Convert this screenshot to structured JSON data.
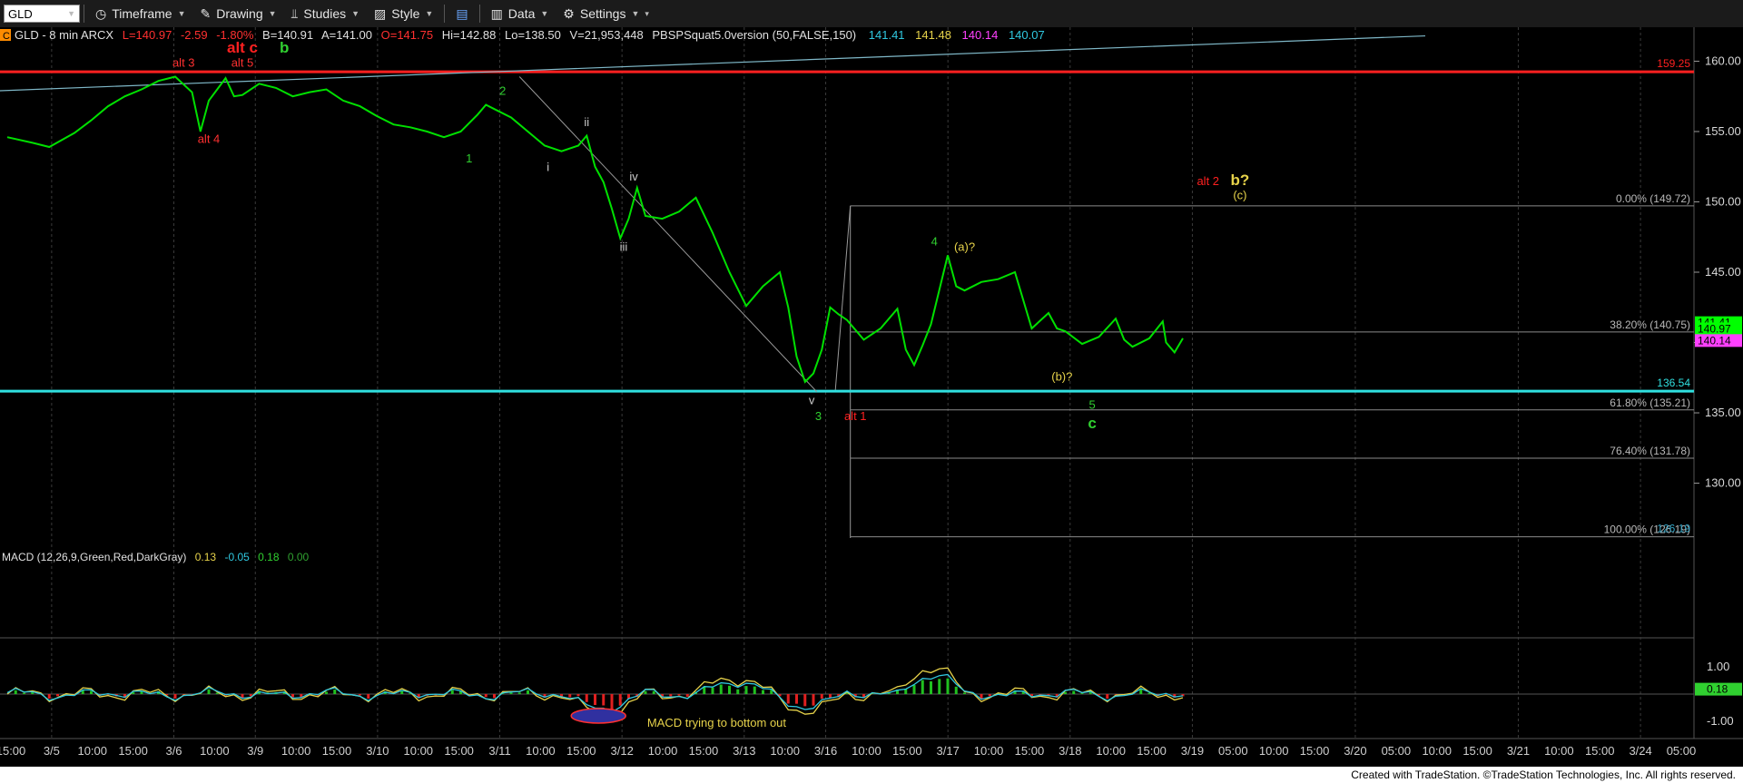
{
  "toolbar": {
    "symbol": "GLD",
    "timeframe": "Timeframe",
    "drawing": "Drawing",
    "studies": "Studies",
    "style": "Style",
    "data": "Data",
    "settings": "Settings"
  },
  "header": {
    "badge": "C",
    "title": "GLD - 8 min  ARCX",
    "L": "L=140.97",
    "chg": "-2.59",
    "pct": "-1.80%",
    "B": "B=140.91",
    "A": "A=141.00",
    "O": "O=141.75",
    "Hi": "Hi=142.88",
    "Lo": "Lo=138.50",
    "V": "V=21,953,448",
    "study": "PBSPSquat5.0version (50,FALSE,150)",
    "study_values": [
      "141.41",
      "141.48",
      "140.14",
      "140.07"
    ]
  },
  "macd_header": {
    "label": "MACD (12,26,9,Green,Red,DarkGray)",
    "v1": "0.13",
    "v2": "-0.05",
    "v3": "0.18",
    "v4": "0.00"
  },
  "footer": "Created with TradeStation. ©TradeStation Technologies, Inc. All rights reserved.",
  "colors": {
    "price": "#00ff00",
    "red_line": "#ff2020",
    "cyan_line": "#30e0e0",
    "grid": "#3a3a3a"
  },
  "chart_data": {
    "type": "line",
    "symbol": "GLD",
    "interval": "8 min",
    "ylim": [
      126.1,
      161.9
    ],
    "y_ticks": [
      130,
      135,
      140,
      145,
      150,
      155,
      160
    ],
    "x_ticks": [
      "15:00",
      "3/5",
      "10:00",
      "15:00",
      "3/6",
      "10:00",
      "3/9",
      "10:00",
      "15:00",
      "3/10",
      "10:00",
      "15:00",
      "3/11",
      "10:00",
      "15:00",
      "3/12",
      "10:00",
      "15:00",
      "3/13",
      "10:00",
      "3/16",
      "10:00",
      "15:00",
      "3/17",
      "10:00",
      "15:00",
      "3/18",
      "10:00",
      "15:00",
      "3/19",
      "05:00",
      "10:00",
      "15:00",
      "3/20",
      "05:00",
      "10:00",
      "15:00",
      "3/21",
      "10:00",
      "15:00",
      "3/24",
      "05:00"
    ],
    "price_path": [
      [
        0,
        154.6
      ],
      [
        1.5,
        154.2
      ],
      [
        2.5,
        153.9
      ],
      [
        4,
        154.9
      ],
      [
        5,
        155.8
      ],
      [
        6,
        156.8
      ],
      [
        7,
        157.5
      ],
      [
        8,
        158.0
      ],
      [
        9,
        158.6
      ],
      [
        10,
        158.9
      ],
      [
        11,
        157.8
      ],
      [
        11.5,
        155.0
      ],
      [
        12,
        157.2
      ],
      [
        13,
        158.8
      ],
      [
        13.5,
        157.5
      ],
      [
        14,
        157.6
      ],
      [
        15,
        158.4
      ],
      [
        16,
        158.1
      ],
      [
        17,
        157.5
      ],
      [
        18,
        157.8
      ],
      [
        19,
        158.0
      ],
      [
        20,
        157.2
      ],
      [
        21,
        156.8
      ],
      [
        22,
        156.1
      ],
      [
        23,
        155.5
      ],
      [
        24,
        155.3
      ],
      [
        25,
        155.0
      ],
      [
        26,
        154.6
      ],
      [
        27,
        155.0
      ],
      [
        28,
        156.2
      ],
      [
        28.5,
        156.9
      ],
      [
        29,
        156.6
      ],
      [
        30,
        156.0
      ],
      [
        31,
        155.0
      ],
      [
        32,
        154.0
      ],
      [
        33,
        153.6
      ],
      [
        34,
        154.0
      ],
      [
        34.5,
        154.7
      ],
      [
        35,
        152.5
      ],
      [
        35.5,
        151.4
      ],
      [
        36,
        149.5
      ],
      [
        36.5,
        147.4
      ],
      [
        37,
        148.8
      ],
      [
        37.5,
        151.0
      ],
      [
        38,
        149.0
      ],
      [
        39,
        148.8
      ],
      [
        40,
        149.3
      ],
      [
        41,
        150.3
      ],
      [
        42,
        147.8
      ],
      [
        43,
        145.0
      ],
      [
        44,
        142.6
      ],
      [
        45,
        144.0
      ],
      [
        46,
        145.0
      ],
      [
        46.5,
        142.5
      ],
      [
        47,
        139.0
      ],
      [
        47.5,
        137.2
      ],
      [
        48,
        137.8
      ],
      [
        48.5,
        139.5
      ],
      [
        49,
        142.5
      ],
      [
        49.5,
        142.0
      ],
      [
        50,
        141.6
      ],
      [
        51,
        140.2
      ],
      [
        52,
        141.0
      ],
      [
        53,
        142.4
      ],
      [
        53.5,
        139.5
      ],
      [
        54,
        138.4
      ],
      [
        54.5,
        139.8
      ],
      [
        55,
        141.3
      ],
      [
        56,
        146.2
      ],
      [
        56.5,
        144.0
      ],
      [
        57,
        143.7
      ],
      [
        58,
        144.3
      ],
      [
        59,
        144.5
      ],
      [
        60,
        145.0
      ],
      [
        61,
        141.0
      ],
      [
        62,
        142.1
      ],
      [
        62.5,
        141.0
      ],
      [
        63,
        140.8
      ],
      [
        64,
        139.9
      ],
      [
        65,
        140.4
      ],
      [
        66,
        141.7
      ],
      [
        66.5,
        140.2
      ],
      [
        67,
        139.7
      ],
      [
        68,
        140.3
      ],
      [
        68.8,
        141.5
      ],
      [
        69,
        140.0
      ],
      [
        69.5,
        139.3
      ],
      [
        70,
        140.3
      ]
    ],
    "time_span": [
      0,
      100
    ],
    "axis_tags": [
      {
        "value": 159.25,
        "label": "159.25",
        "color": "#ff2020"
      },
      {
        "value": 141.41,
        "label": "141.41",
        "color": "#00ff00"
      },
      {
        "value": 140.97,
        "label": "140.97",
        "color": "#00ff00"
      },
      {
        "value": 140.14,
        "label": "140.14",
        "color": "#ff40ff"
      },
      {
        "value": 136.54,
        "label": "136.54",
        "color": "#30e0e0"
      },
      {
        "value": 126.19,
        "label": "126.19",
        "color": "#30a0c0"
      }
    ],
    "horizontal_lines": [
      {
        "value": 159.25,
        "color": "#ff2020"
      },
      {
        "value": 136.54,
        "color": "#30e0e0"
      }
    ],
    "fib_levels": [
      {
        "label": "0.00% (149.72)",
        "value": 149.72
      },
      {
        "label": "38.20% (140.75)",
        "value": 140.75
      },
      {
        "label": "61.80% (135.21)",
        "value": 135.21
      },
      {
        "label": "76.40% (131.78)",
        "value": 131.78
      },
      {
        "label": "100.00% (126.19)",
        "value": 126.19
      }
    ],
    "wave_labels": [
      {
        "text": "alt 3",
        "t": 10.5,
        "v": 159.6,
        "color": "#ff3030"
      },
      {
        "text": "alt 5",
        "t": 14,
        "v": 159.6,
        "color": "#ff3030"
      },
      {
        "text": "alt c",
        "t": 14,
        "v": 160.6,
        "color": "#ff2020"
      },
      {
        "text": "b",
        "t": 16.5,
        "v": 160.6,
        "color": "#30d030"
      },
      {
        "text": "alt 4",
        "t": 12,
        "v": 154.2,
        "color": "#ff3030"
      },
      {
        "text": "1",
        "t": 27.5,
        "v": 152.8,
        "color": "#30d030"
      },
      {
        "text": "2",
        "t": 29.5,
        "v": 157.6,
        "color": "#30d030"
      },
      {
        "text": "i",
        "t": 32.2,
        "v": 152.2,
        "color": "#ccc"
      },
      {
        "text": "ii",
        "t": 34.5,
        "v": 155.4,
        "color": "#ccc"
      },
      {
        "text": "iii",
        "t": 36.7,
        "v": 146.5,
        "color": "#ccc"
      },
      {
        "text": "iv",
        "t": 37.3,
        "v": 151.5,
        "color": "#ccc"
      },
      {
        "text": "v",
        "t": 47.9,
        "v": 135.6,
        "color": "#ccc"
      },
      {
        "text": "3",
        "t": 48.3,
        "v": 134.5,
        "color": "#30d030"
      },
      {
        "text": "alt 1",
        "t": 50.5,
        "v": 134.5,
        "color": "#ff2020"
      },
      {
        "text": "4",
        "t": 55.2,
        "v": 146.9,
        "color": "#30d030"
      },
      {
        "text": "(a)?",
        "t": 57,
        "v": 146.5,
        "color": "#e6d24a"
      },
      {
        "text": "(b)?",
        "t": 62.8,
        "v": 137.3,
        "color": "#e6d24a"
      },
      {
        "text": "5",
        "t": 64.6,
        "v": 135.3,
        "color": "#30d030"
      },
      {
        "text": "c",
        "t": 64.6,
        "v": 133.9,
        "color": "#30d030"
      },
      {
        "text": "alt 2",
        "t": 71.5,
        "v": 151.2,
        "color": "#ff2020"
      },
      {
        "text": "b?",
        "t": 73.4,
        "v": 151.2,
        "color": "#e6d24a"
      },
      {
        "text": "(c)",
        "t": 73.4,
        "v": 150.2,
        "color": "#e6d24a"
      }
    ],
    "macd": {
      "ylim": [
        -1.5,
        1.5
      ],
      "y_ticks": [
        1.0,
        0.18,
        -1.0
      ],
      "annotation": "MACD trying to bottom out"
    }
  }
}
